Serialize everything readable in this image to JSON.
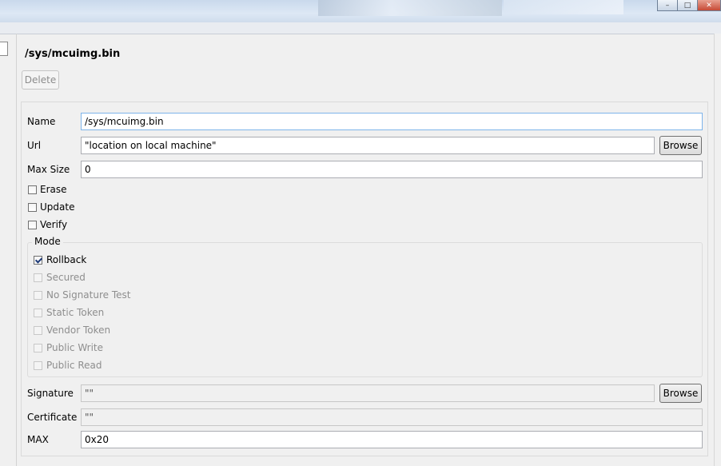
{
  "title": "/sys/mcuimg.bin",
  "delete_label": "Delete",
  "fields": {
    "name": {
      "label": "Name",
      "value": "/sys/mcuimg.bin"
    },
    "url": {
      "label": "Url",
      "value": "\"location on local machine\"",
      "browse": "Browse"
    },
    "max_size": {
      "label": "Max Size",
      "value": "0"
    },
    "signature": {
      "label": "Signature",
      "value": "\"\"",
      "browse": "Browse"
    },
    "certificate": {
      "label": "Certificate",
      "value": "\"\""
    },
    "max": {
      "label": "MAX",
      "value": "0x20"
    }
  },
  "options": [
    {
      "label": "Erase",
      "checked": false
    },
    {
      "label": "Update",
      "checked": false
    },
    {
      "label": "Verify",
      "checked": false
    }
  ],
  "mode": {
    "title": "Mode",
    "items": [
      {
        "label": "Rollback",
        "checked": true,
        "enabled": true
      },
      {
        "label": "Secured",
        "checked": false,
        "enabled": false
      },
      {
        "label": "No Signature Test",
        "checked": false,
        "enabled": false
      },
      {
        "label": "Static Token",
        "checked": false,
        "enabled": false
      },
      {
        "label": "Vendor Token",
        "checked": false,
        "enabled": false
      },
      {
        "label": "Public Write",
        "checked": false,
        "enabled": false
      },
      {
        "label": "Public Read",
        "checked": false,
        "enabled": false
      }
    ]
  },
  "window_buttons": {
    "minimize": "–",
    "maximize": "□",
    "close": "✕"
  },
  "colors": {
    "background": "#f0f0f0",
    "field_border": "#abadb3",
    "focus_border": "#7eb4ea",
    "disabled_text": "#8e8e8e"
  }
}
